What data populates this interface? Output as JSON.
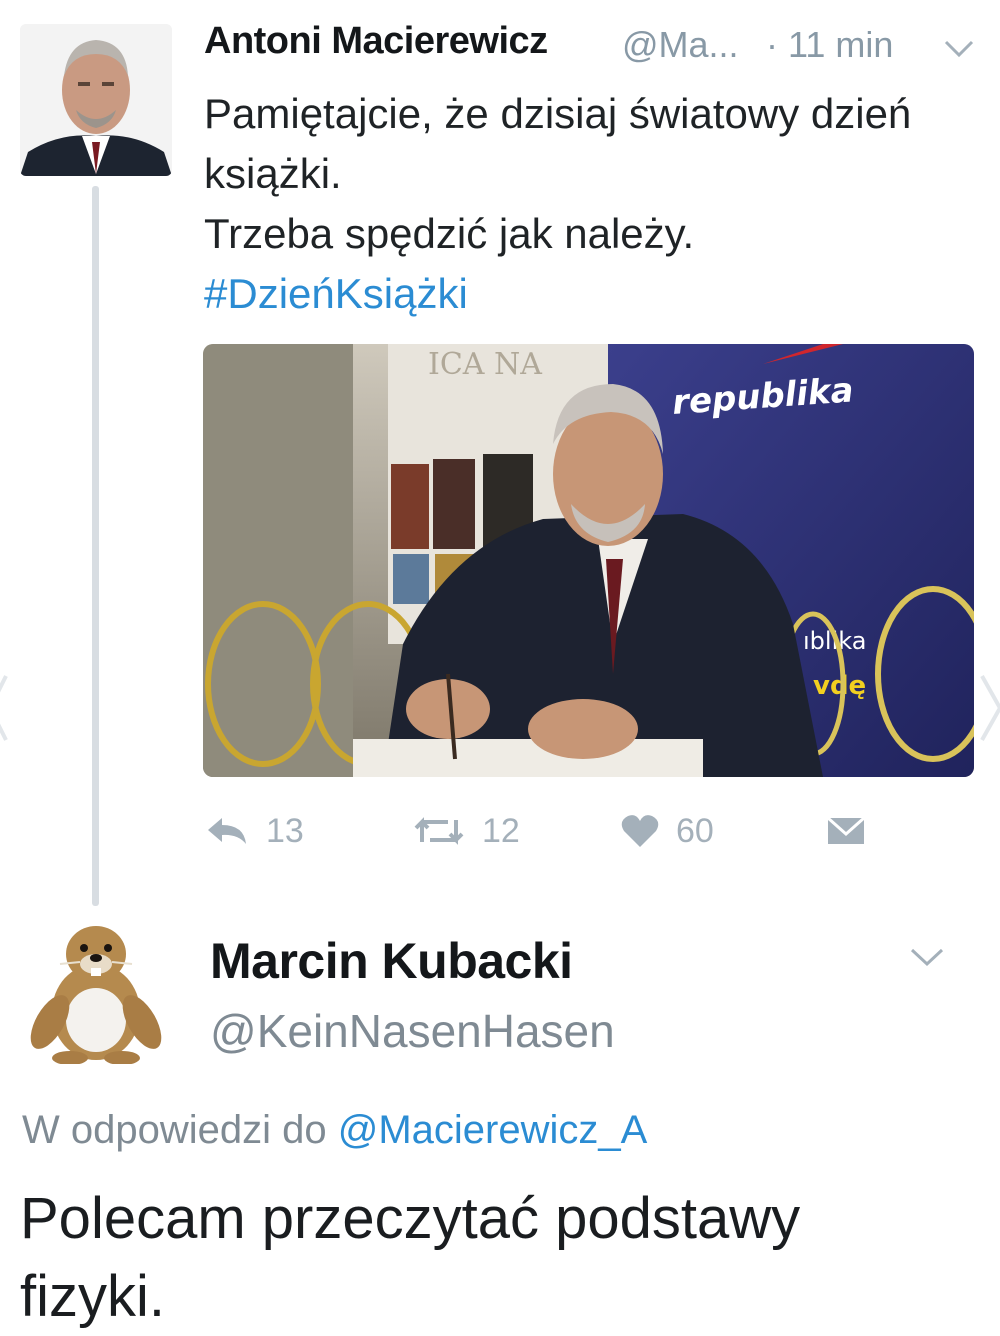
{
  "tweet1": {
    "author_name": "Antoni Macierewicz",
    "handle": "@Ma...",
    "time": "· 11 min",
    "lines": [
      "Pamiętajcie, że dzisiaj światowy dzień",
      "książki.",
      "Trzeba spędzić jak należy."
    ],
    "hashtag": "#DzieńKsiążki",
    "photo": {
      "banner_text": "republika",
      "banner_text2": "ıblika",
      "banner_text3": "vdę",
      "poster_text": "ICA NA"
    },
    "actions": {
      "reply_count": "13",
      "retweet_count": "12",
      "like_count": "60"
    }
  },
  "tweet2": {
    "author_name": "Marcin Kubacki",
    "handle": "@KeinNasenHasen",
    "reply_prefix": "W odpowiedzi do ",
    "reply_mention": "@Macierewicz_A",
    "lines": [
      "Polecam przeczytać podstawy",
      "fizyki."
    ]
  },
  "icons": {
    "reply": "reply-icon",
    "retweet": "retweet-icon",
    "like": "heart-icon",
    "dm": "direct-message-icon",
    "menu": "chevron-down-icon"
  },
  "colors": {
    "link": "#2b8cd3",
    "muted": "#8899a6",
    "action": "#a4b0ba",
    "thread_line": "#d8dde2"
  }
}
